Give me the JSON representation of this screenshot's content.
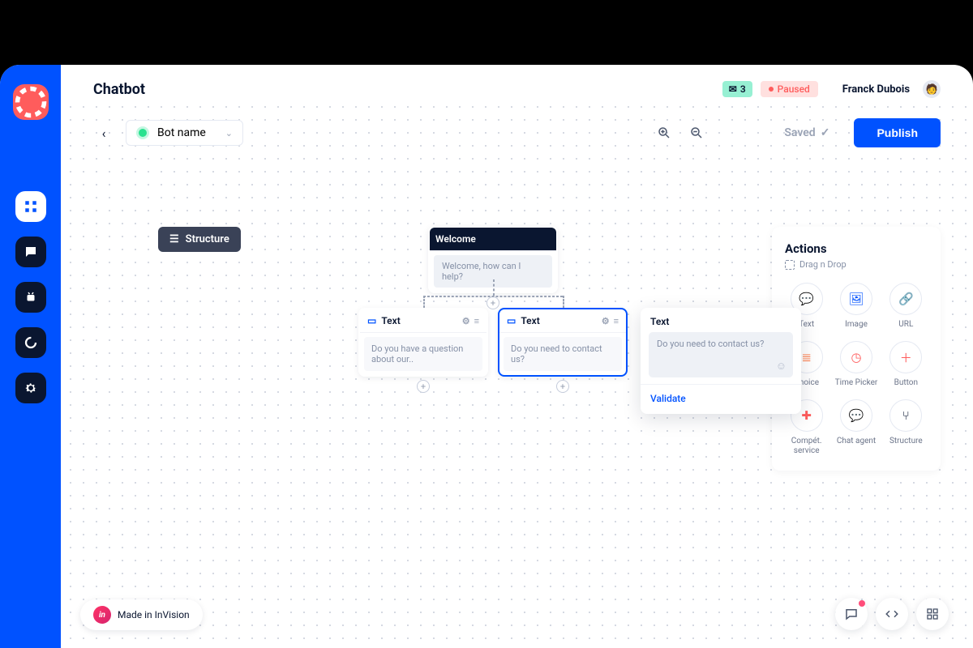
{
  "header": {
    "title": "Chatbot",
    "mail_count": "3",
    "status": "Paused",
    "user": "Franck Dubois"
  },
  "toolbar": {
    "bot_name": "Bot name",
    "saved": "Saved",
    "publish": "Publish"
  },
  "structure_button": "Structure",
  "nodes": {
    "welcome": {
      "title": "Welcome",
      "body": "Welcome, how can I help?"
    },
    "text1": {
      "title": "Text",
      "body": "Do you have a question about our.."
    },
    "text2": {
      "title": "Text",
      "body": "Do you need to contact us?"
    }
  },
  "edit": {
    "title": "Text",
    "placeholder": "Do you need to contact us?",
    "validate": "Validate"
  },
  "actions": {
    "title": "Actions",
    "hint": "Drag n Drop",
    "items": [
      {
        "label": "Text",
        "color": "#0052ff",
        "glyph": "💬"
      },
      {
        "label": "Image",
        "color": "#0052ff",
        "glyph": "🖼"
      },
      {
        "label": "URL",
        "color": "#8590a6",
        "glyph": "🔗"
      },
      {
        "label": "Choice",
        "color": "#ff7a45",
        "glyph": "≣"
      },
      {
        "label": "Time Picker",
        "color": "#ff5c5c",
        "glyph": "◷"
      },
      {
        "label": "Button",
        "color": "#ff5c5c",
        "glyph": "＋"
      },
      {
        "label": "Compét. service",
        "color": "#ff5c5c",
        "glyph": "✚"
      },
      {
        "label": "Chat agent",
        "color": "#0a1630",
        "glyph": "💬"
      },
      {
        "label": "Structure",
        "color": "#0a1630",
        "glyph": "⑂"
      }
    ]
  },
  "invision": "Made in InVision",
  "colors": {
    "primary": "#0052ff",
    "dark": "#0a1630"
  }
}
